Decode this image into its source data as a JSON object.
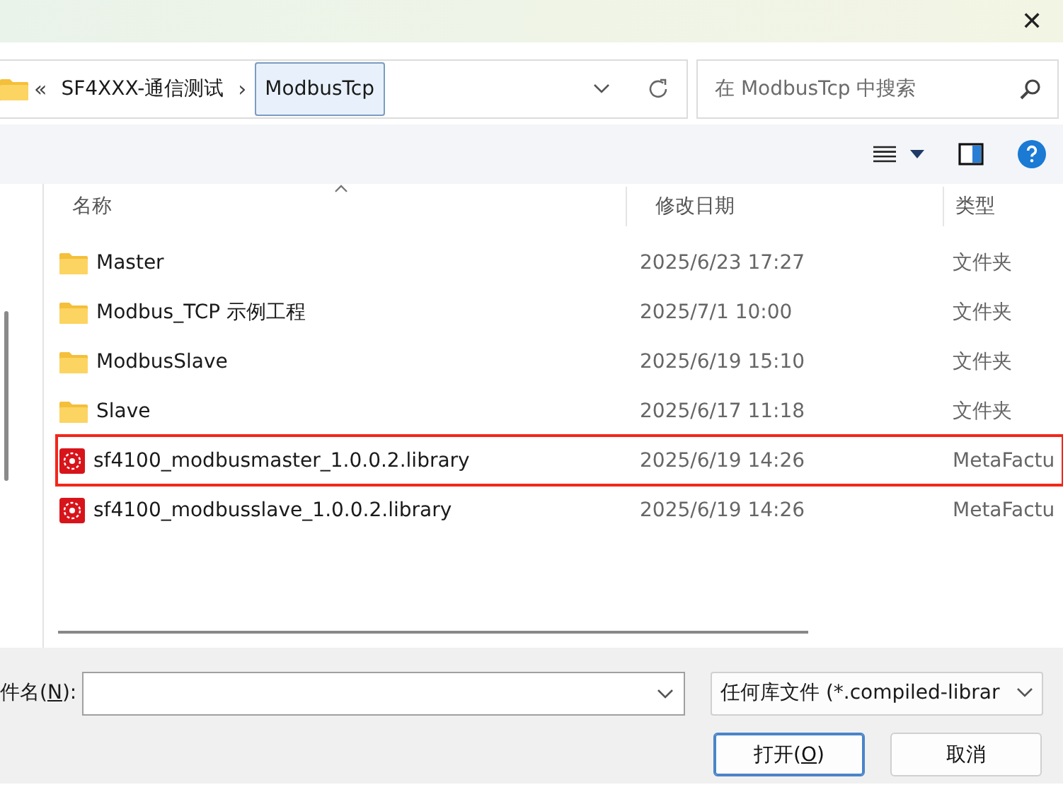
{
  "window": {
    "close_label": "✕"
  },
  "address_bar": {
    "path": [
      {
        "label": "SF4XXX-通信测试",
        "selected": false
      },
      {
        "label": "ModbusTcp",
        "selected": true
      }
    ],
    "overflow": "«",
    "separator": "›"
  },
  "search": {
    "placeholder": "在 ModbusTcp 中搜索"
  },
  "table": {
    "columns": [
      {
        "label": "名称",
        "sorted": true
      },
      {
        "label": "修改日期",
        "sorted": false
      },
      {
        "label": "类型",
        "sorted": false
      }
    ],
    "rows": [
      {
        "kind": "folder",
        "name": "Master",
        "date": "2025/6/23 17:27",
        "type": "文件夹",
        "outlined": false
      },
      {
        "kind": "folder",
        "name": "Modbus_TCP 示例工程",
        "date": "2025/7/1 10:00",
        "type": "文件夹",
        "outlined": false
      },
      {
        "kind": "folder",
        "name": "ModbusSlave",
        "date": "2025/6/19 15:10",
        "type": "文件夹",
        "outlined": false
      },
      {
        "kind": "folder",
        "name": "Slave",
        "date": "2025/6/17 11:18",
        "type": "文件夹",
        "outlined": false
      },
      {
        "kind": "library",
        "name": "sf4100_modbusmaster_1.0.0.2.library",
        "date": "2025/6/19 14:26",
        "type": "MetaFactu",
        "outlined": true
      },
      {
        "kind": "library",
        "name": "sf4100_modbusslave_1.0.0.2.library",
        "date": "2025/6/19 14:26",
        "type": "MetaFactu",
        "outlined": false
      }
    ]
  },
  "footer": {
    "filename_label": {
      "before": "件名(",
      "mnemonic": "N",
      "after": "):"
    },
    "filter": "任何库文件 (*.compiled-librar",
    "buttons": [
      {
        "before": "打开(",
        "mnemonic": "O",
        "after": ")",
        "default": true
      },
      {
        "before": "取消",
        "default": false
      }
    ]
  }
}
